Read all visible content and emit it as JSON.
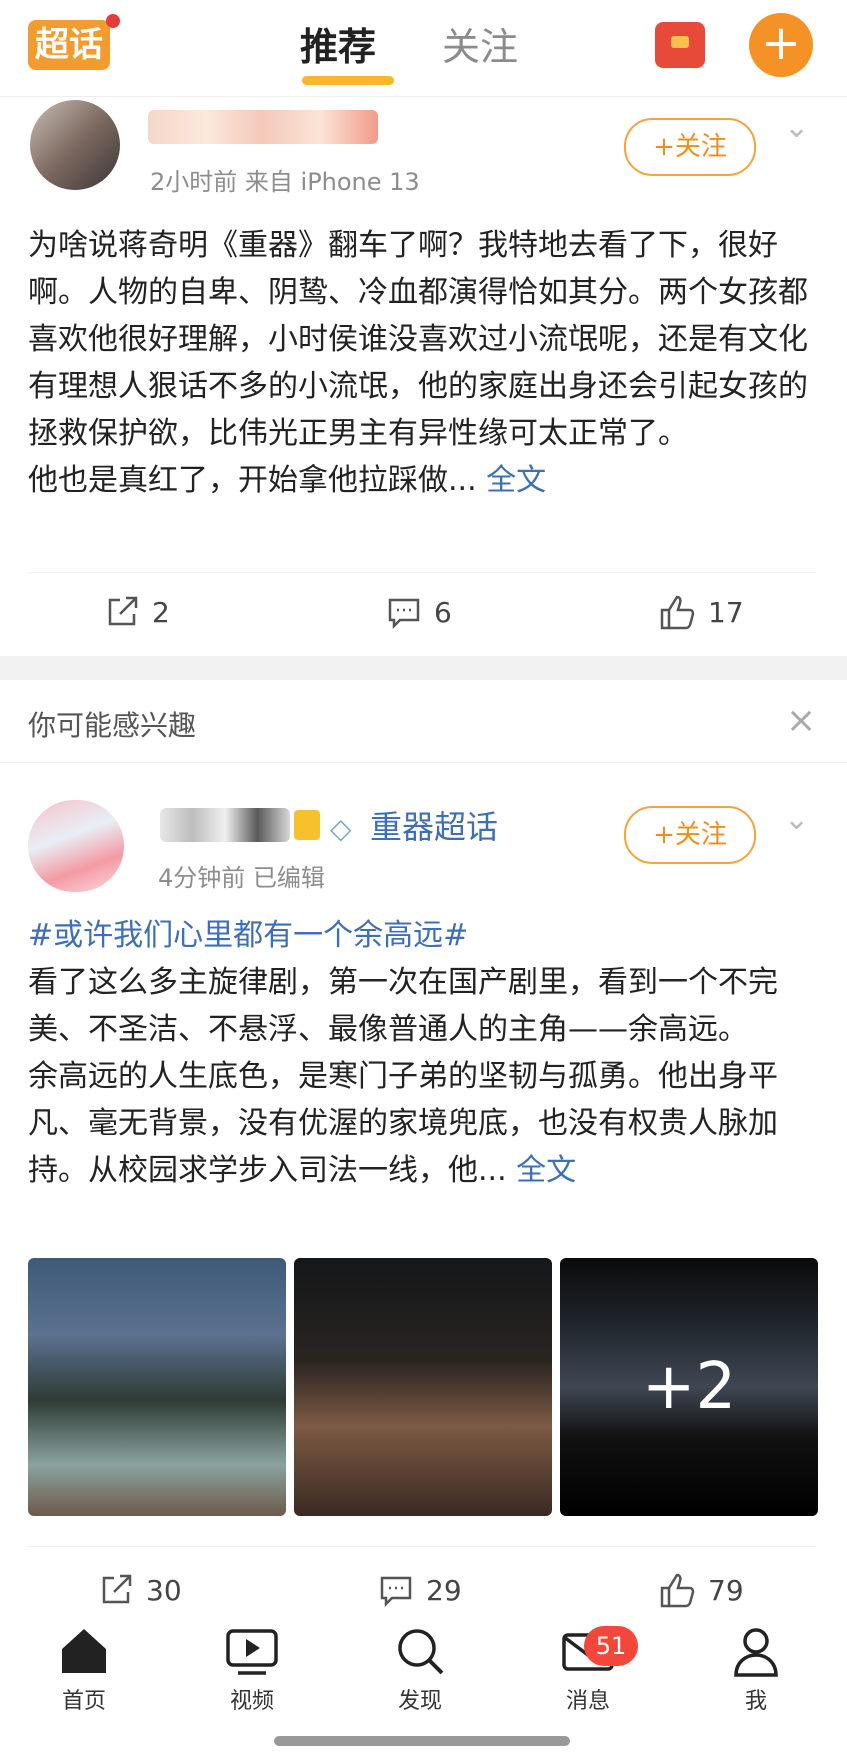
{
  "header": {
    "logo_text": "超话",
    "tabs": [
      {
        "label": "推荐"
      },
      {
        "label": "关注"
      }
    ],
    "add_icon": "plus-icon",
    "redpacket_icon": "red-packet-icon"
  },
  "post1": {
    "meta": "2小时前  来自 iPhone 13",
    "follow_label": "+关注",
    "body": [
      "为啥说蒋奇明《重器》翻车了啊？我特地去看了下，很好啊。人物的自卑、阴鸷、冷血都演得恰如其分。两个女孩都喜欢他很好理解，小时侯谁没喜欢过小流氓呢，还是有文化有理想人狠话不多的小流氓，他的家庭出身还会引起女孩的拯救保护欲，比伟光正男主有异性缘可太正常了。"
    ],
    "last_line": "他也是真红了，开始拿他拉踩做...",
    "more_label": "全文",
    "repost_count": "2",
    "comment_count": "6",
    "like_count": "17"
  },
  "suggest": {
    "title": "你可能感兴趣"
  },
  "post2": {
    "topic_name": "重器超话",
    "meta": "4分钟前  已编辑",
    "follow_label": "+关注",
    "hashtag": "#或许我们心里都有一个余高远#",
    "body": [
      "看了这么多主旋律剧，第一次在国产剧里，看到一个不完美、不圣洁、不悬浮、最像普通人的主角——余高远。"
    ],
    "last_line": "余高远的人生底色，是寒门子弟的坚韧与孤勇。他出身平凡、毫无背景，没有优渥的家境兜底，也没有权贵人脉加持。从校园求学步入司法一线，他...",
    "more_label": "全文",
    "more_images": "+2",
    "repost_count": "30",
    "comment_count": "29",
    "like_count": "79"
  },
  "nav": {
    "items": [
      {
        "label": "首页",
        "icon": "home-icon"
      },
      {
        "label": "视频",
        "icon": "video-icon"
      },
      {
        "label": "发现",
        "icon": "search-icon"
      },
      {
        "label": "消息",
        "icon": "message-icon"
      },
      {
        "label": "我",
        "icon": "profile-icon"
      }
    ],
    "message_badge": "51"
  },
  "colors": {
    "accent": "#f59226",
    "link": "#3c6fb5",
    "badge": "#f2473a"
  }
}
